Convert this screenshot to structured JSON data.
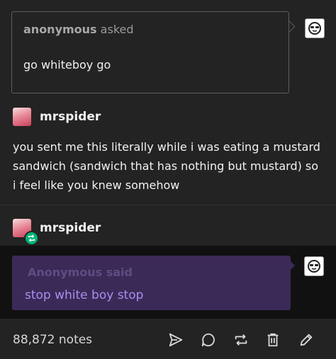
{
  "ask": {
    "asker_name": "anonymous",
    "asked_label": "asked",
    "question": "go whiteboy go"
  },
  "answer": {
    "username": "mrspider",
    "text": "you sent me this literally while i was eating a mustard sandwich (sandwich that has nothing but mustard) so i feel like you knew somehow"
  },
  "reblog": {
    "username": "mrspider",
    "anon_said": "Anonymous said",
    "question": "stop white boy stop"
  },
  "footer": {
    "notes": "88,872 notes",
    "icons": [
      "share-icon",
      "reply-icon",
      "reblog-icon",
      "delete-icon",
      "edit-icon"
    ]
  },
  "colors": {
    "background": "#232323",
    "ask_border": "#5e5e5e",
    "purple_box": "#3b2a57",
    "purple_text": "#a98ff0",
    "reblog_badge": "#00b37a"
  }
}
